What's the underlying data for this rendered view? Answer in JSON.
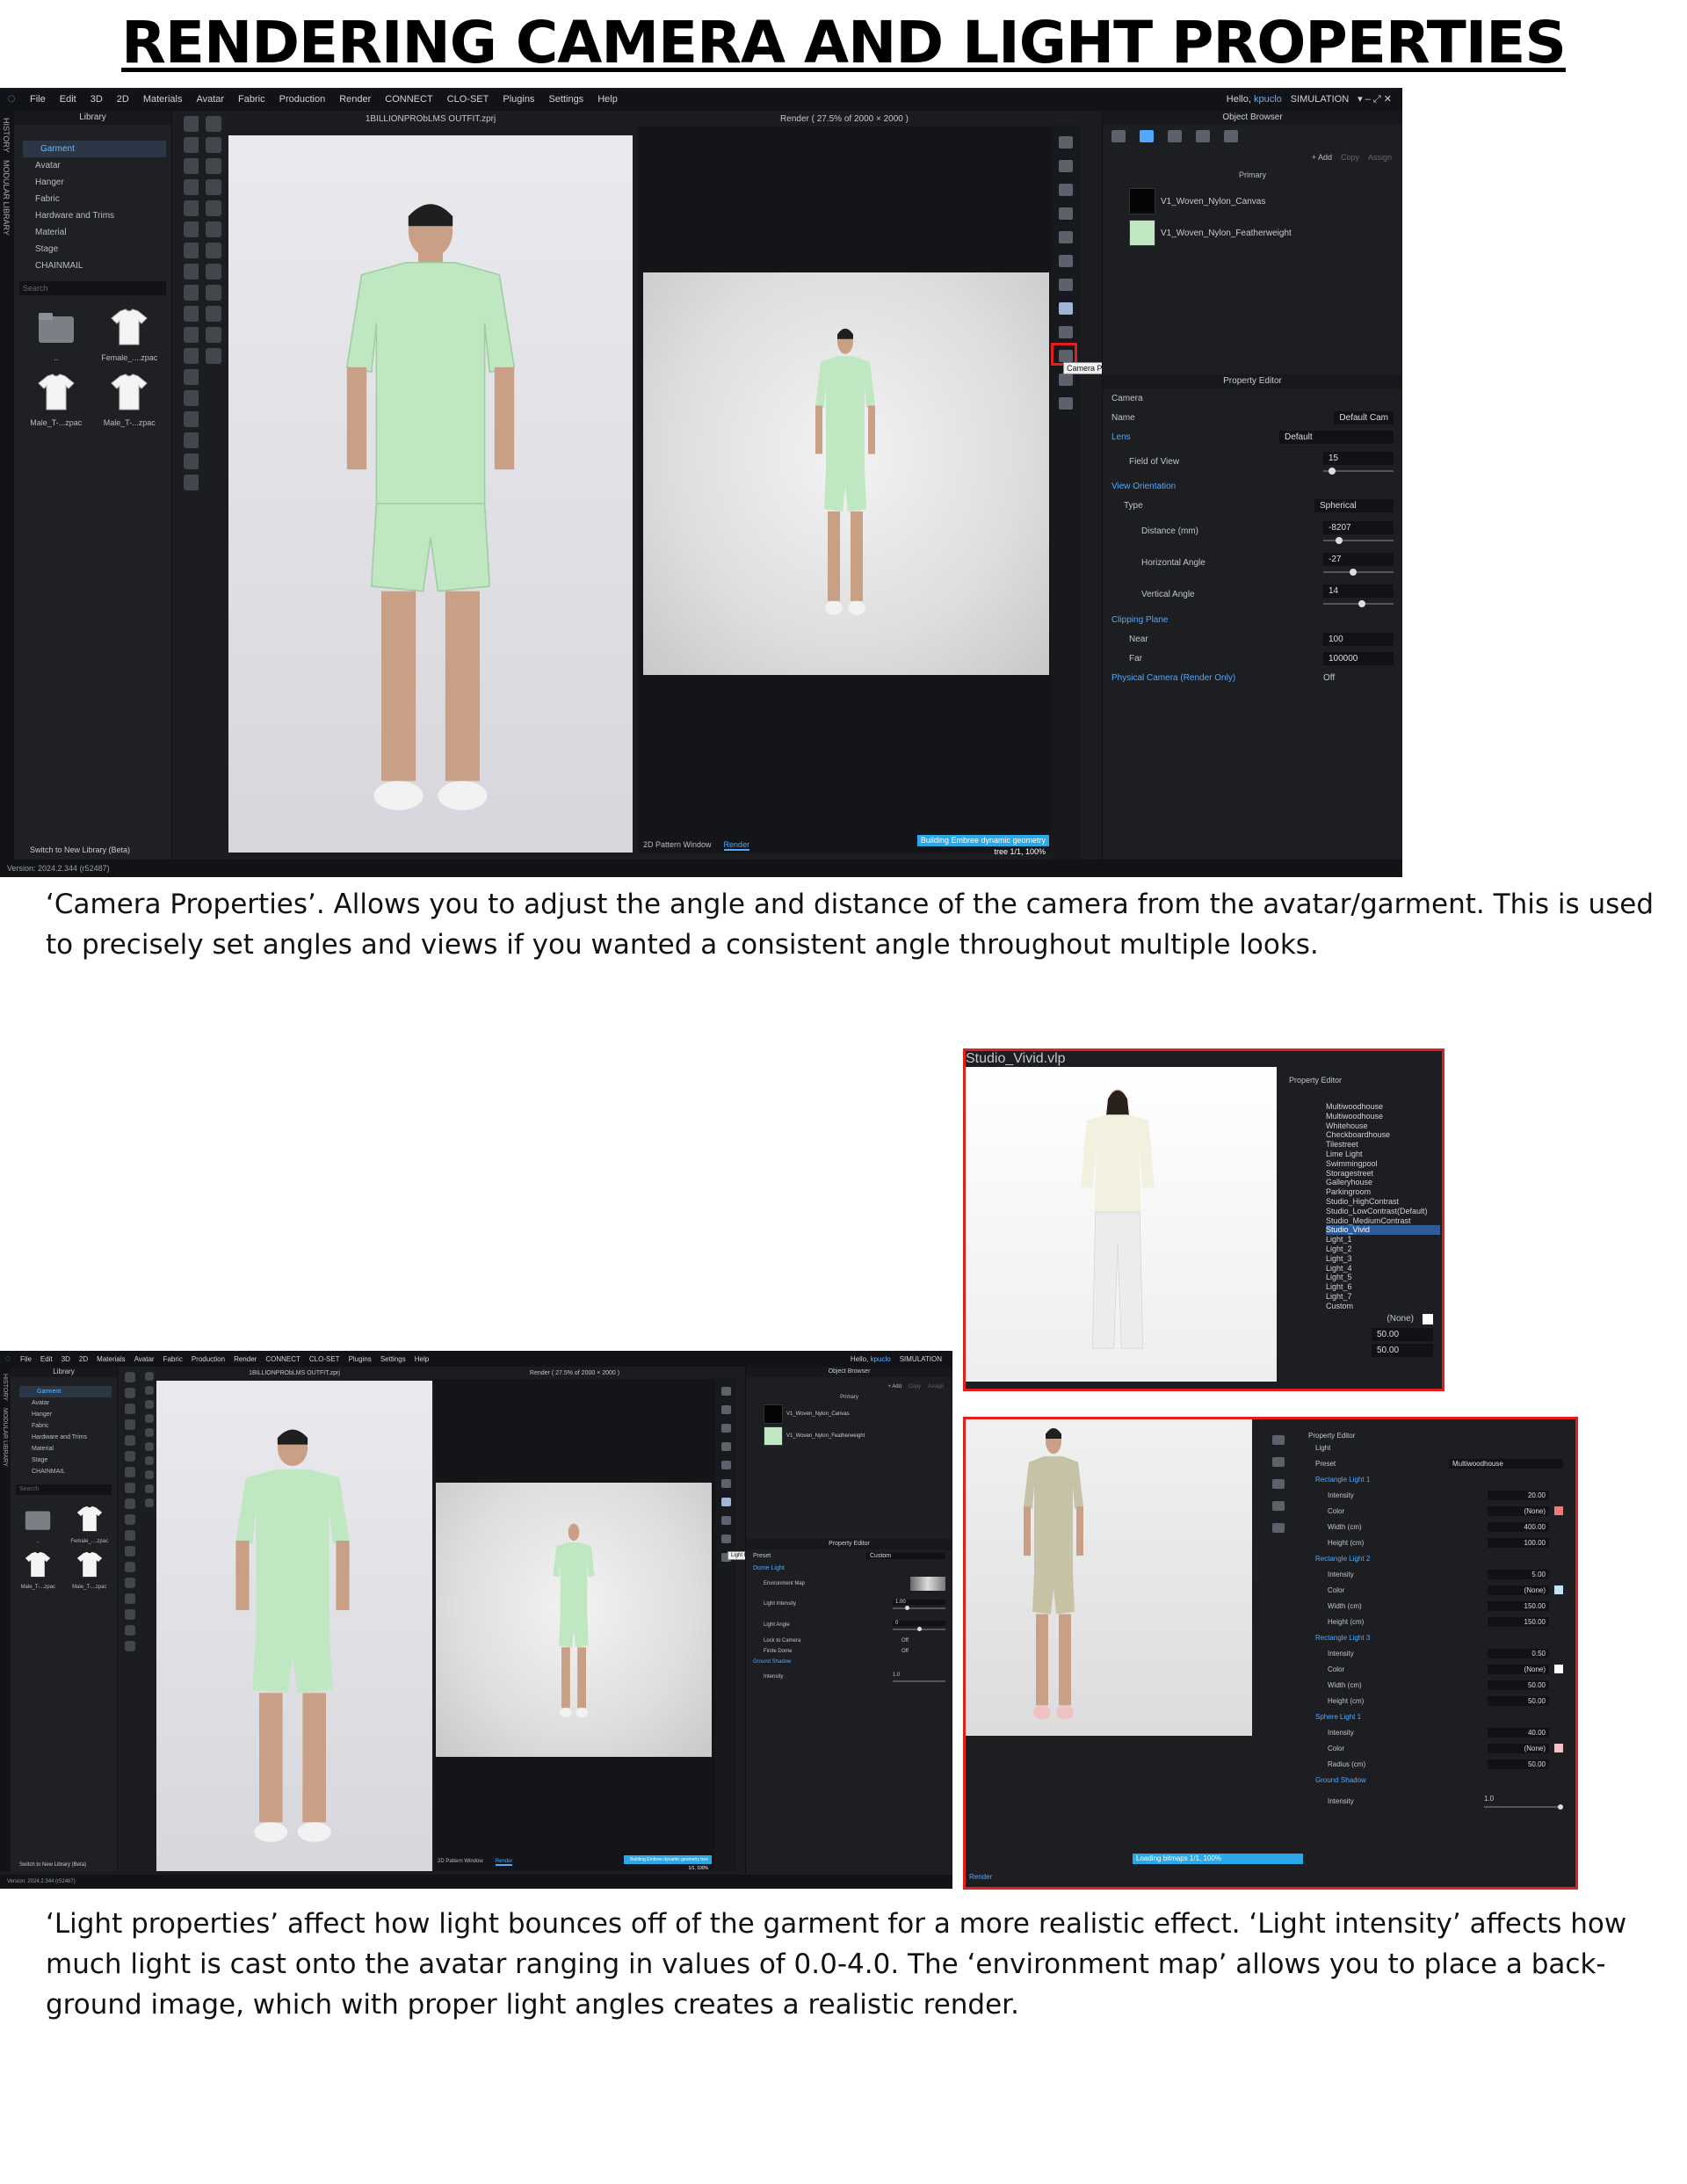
{
  "title": "RENDERING CAMERA AND LIGHT PROPERTIES",
  "caption_camera": "‘Camera Properties’. Allows you to adjust the angle and distance of the camera from the avatar/garment. This is used to precisely set angles and views if you wanted a consistent angle throughout multiple looks.",
  "caption_light": "‘Light properties’ affect how light bounces off of the garment for a more realistic effect. ‘Light intensity’ affects how much light is cast onto the avatar ranging in values of 0.0-4.0. The ‘environment map’ allows you to place a back-ground image, which with proper light angles creates a realistic render.",
  "app": {
    "menu": [
      "File",
      "Edit",
      "3D",
      "2D",
      "Materials",
      "Avatar",
      "Fabric",
      "Production",
      "Render",
      "CONNECT",
      "CLO-SET",
      "Plugins",
      "Settings",
      "Help"
    ],
    "greeting": "Hello,",
    "username": "kpuclo",
    "mode": "SIMULATION",
    "side_tabs": [
      "HISTORY",
      "MODULAR LIBRARY"
    ],
    "library_title": "Library",
    "library_tree": [
      "Garment",
      "Avatar",
      "Hanger",
      "Fabric",
      "Hardware and Trims",
      "Material",
      "Stage",
      "CHAINMAIL"
    ],
    "search_placeholder": "Search",
    "thumbs": [
      "..",
      "Female_....zpac",
      "Male_T-...zpac",
      "Male_T-...zpac"
    ],
    "switch_library": "Switch to New Library (Beta)",
    "version": "Version: 2024.2.344 (r52487)",
    "viewport_title": "1BILLIONPRObLMS OUTFIT.zprj",
    "render_title": "Render ( 27.5% of 2000 × 2000 )",
    "tab_2d": "2D Pattern Window",
    "tab_render": "Render",
    "progress": "Building Embree dynamic geometry tree 1/1, 100%",
    "object_browser": "Object Browser",
    "add": "+ Add",
    "copy": "Copy",
    "assign": "Assign",
    "primary": "Primary",
    "fabrics": [
      "V1_Woven_Nylon_Canvas",
      "V1_Woven_Nylon_Featherweight"
    ],
    "property_editor": "Property Editor",
    "tooltip_camera": "Camera Properties",
    "tooltip_light": "Light Properties"
  },
  "camera": {
    "header": "Camera",
    "name_label": "Name",
    "name_value": "Default Cam",
    "lens_label": "Lens",
    "lens_value": "Default",
    "fov_label": "Field of View",
    "fov_value": "15",
    "view_orientation": "View Orientation",
    "type_label": "Type",
    "type_value": "Spherical",
    "distance_label": "Distance (mm)",
    "distance_value": "-8207",
    "h_angle_label": "Horizontal Angle",
    "h_angle_value": "-27",
    "v_angle_label": "Vertical Angle",
    "v_angle_value": "14",
    "clipping": "Clipping Plane",
    "near_label": "Near",
    "near_value": "100",
    "far_label": "Far",
    "far_value": "100000",
    "physical_label": "Physical Camera (Render Only)",
    "physical_value": "Off"
  },
  "light_small": {
    "preset_label": "Preset",
    "preset_value": "Custom",
    "dome": "Dome Light",
    "env_map": "Environment Map",
    "intensity_label": "Light Intensity",
    "intensity_value": "1.00",
    "angle_label": "Light Angle",
    "angle_value": "0",
    "lock": "Lock to Camera",
    "lock_value": "Off",
    "finite": "Finite Dome",
    "finite_value": "Off",
    "ground": "Ground Shadow",
    "g_intensity": "Intensity",
    "g_intensity_value": "1.0"
  },
  "studio": {
    "title": "Studio_Vivid.vlp",
    "property_editor": "Property Editor",
    "presets": [
      "Multiwoodhouse",
      "Multiwoodhouse",
      "Whitehouse",
      "Checkboardhouse",
      "Tilestreet",
      "Lime Light",
      "Swimmingpool",
      "Storagestreet",
      "Galleryhouse",
      "Parkingroom",
      "Studio_HighContrast",
      "Studio_LowContrast(Default)",
      "Studio_MediumContrast",
      "Studio_Vivid",
      "Light_1",
      "Light_2",
      "Light_3",
      "Light_4",
      "Light_5",
      "Light_6",
      "Light_7",
      "Custom"
    ],
    "selected": "Studio_Vivid",
    "none": "(None)",
    "v1": "50.00",
    "v2": "50.00"
  },
  "light_large": {
    "header": "Light",
    "preset_label": "Preset",
    "preset_value": "Multiwoodhouse",
    "lights": [
      {
        "name": "Rectangle Light 1",
        "intensity": "20.00",
        "color": "(None)",
        "swatch": "#f07a7a",
        "d1_label": "Width (cm)",
        "d1": "400.00",
        "d2_label": "Height (cm)",
        "d2": "100.00"
      },
      {
        "name": "Rectangle Light 2",
        "intensity": "5.00",
        "color": "(None)",
        "swatch": "#bfe6f6",
        "d1_label": "Width (cm)",
        "d1": "150.00",
        "d2_label": "Height (cm)",
        "d2": "150.00"
      },
      {
        "name": "Rectangle Light 3",
        "intensity": "0.50",
        "color": "(None)",
        "swatch": "#ffffff",
        "d1_label": "Width (cm)",
        "d1": "50.00",
        "d2_label": "Height (cm)",
        "d2": "50.00"
      },
      {
        "name": "Sphere Light 1",
        "intensity": "40.00",
        "color": "(None)",
        "swatch": "#f6c0c8",
        "d1_label": "Radius (cm)",
        "d1": "50.00"
      }
    ],
    "intensity_label": "Intensity",
    "color_label": "Color",
    "ground": "Ground Shadow",
    "g_intensity": "Intensity",
    "g_value": "1.0",
    "progress": "Loading bitmaps 1/1, 100%",
    "render_tab": "Render"
  },
  "colors": {
    "accent": "#4ea9ff",
    "highlight_red": "#e21f1f",
    "garment": "#bfe8c2",
    "app_bg": "#1b1c20"
  }
}
